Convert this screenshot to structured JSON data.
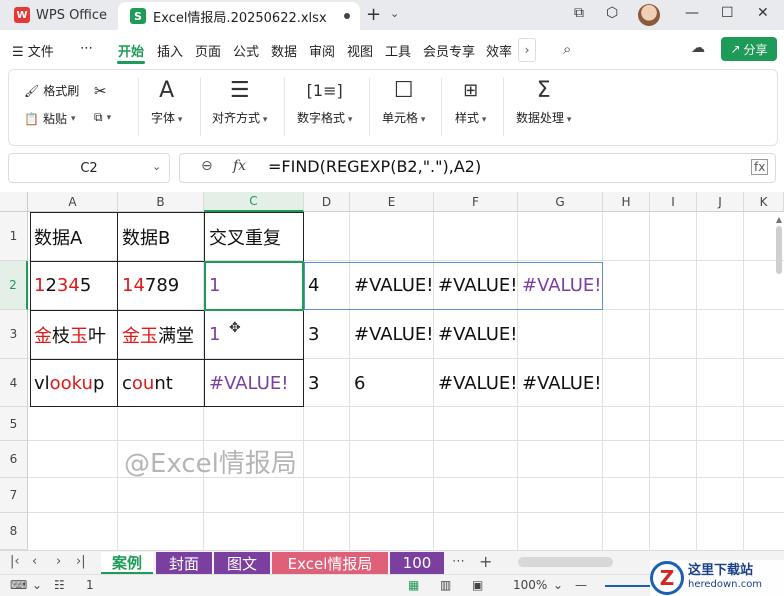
{
  "app": {
    "name": "WPS Office",
    "file_tab": "Excel情报局.20250622.xlsx"
  },
  "menu": {
    "file": "文件",
    "more": "⋯",
    "items": [
      "开始",
      "插入",
      "页面",
      "公式",
      "数据",
      "审阅",
      "视图",
      "工具",
      "会员专享",
      "效率"
    ],
    "active": "开始",
    "share": "分享"
  },
  "ribbon": {
    "format_painter": "格式刷",
    "paste": "粘贴",
    "font": "字体",
    "align": "对齐方式",
    "number": "数字格式",
    "cell": "单元格",
    "style": "样式",
    "data": "数据处理"
  },
  "formula_bar": {
    "name_box": "C2",
    "fx": "fx",
    "formula": "=FIND(REGEXP(B2,\".\"),A2)"
  },
  "columns": [
    "A",
    "B",
    "C",
    "D",
    "E",
    "F",
    "G",
    "H",
    "I",
    "J",
    "K"
  ],
  "rows": [
    "1",
    "2",
    "3",
    "4",
    "5",
    "6",
    "7",
    "8"
  ],
  "cells": {
    "A1": "数据A",
    "B1": "数据B",
    "C1": "交叉重复",
    "A2_p1": "1",
    "A2_p2": "2",
    "A2_p3": "3",
    "A2_p4": "4",
    "A2_p5": "5",
    "B2_p1": "14",
    "B2_p2": "789",
    "C2": "1",
    "D2": "4",
    "E2": "#VALUE!",
    "F2": "#VALUE!",
    "G2": "#VALUE!",
    "A3_p1": "金",
    "A3_p2": "枝",
    "A3_p3": "玉",
    "A3_p4": "叶",
    "B3_p1": "金玉",
    "B3_p2": "满堂",
    "C3": "1",
    "D3": "3",
    "E3": "#VALUE!",
    "F3": "#VALUE!",
    "A4_p1": "vl",
    "A4_p2": "ooku",
    "A4_p3": "p",
    "B4_p1": "c",
    "B4_p2": "ou",
    "B4_p3": "nt",
    "C4": "#VALUE!",
    "D4": "3",
    "E4": "6",
    "F4": "#VALUE!",
    "G4": "#VALUE!"
  },
  "watermark": "@Excel情报局",
  "sheet_tabs": [
    {
      "label": "案例",
      "color": "#ffffff",
      "active": true
    },
    {
      "label": "封面",
      "color": "#7b3fa0"
    },
    {
      "label": "图文",
      "color": "#7b3fa0"
    },
    {
      "label": "Excel情报局",
      "color": "#e0607a"
    },
    {
      "label": "100",
      "color": "#7b3fa0"
    }
  ],
  "tab_more": "⋯",
  "tab_add": "+",
  "status": {
    "count": "1",
    "zoom": "100%"
  },
  "brand": {
    "main": "这里下载站",
    "sub": "heredown.com"
  },
  "colors": {
    "accent": "#1e9b58",
    "red": "#e01818",
    "purple": "#7b3fa0"
  }
}
